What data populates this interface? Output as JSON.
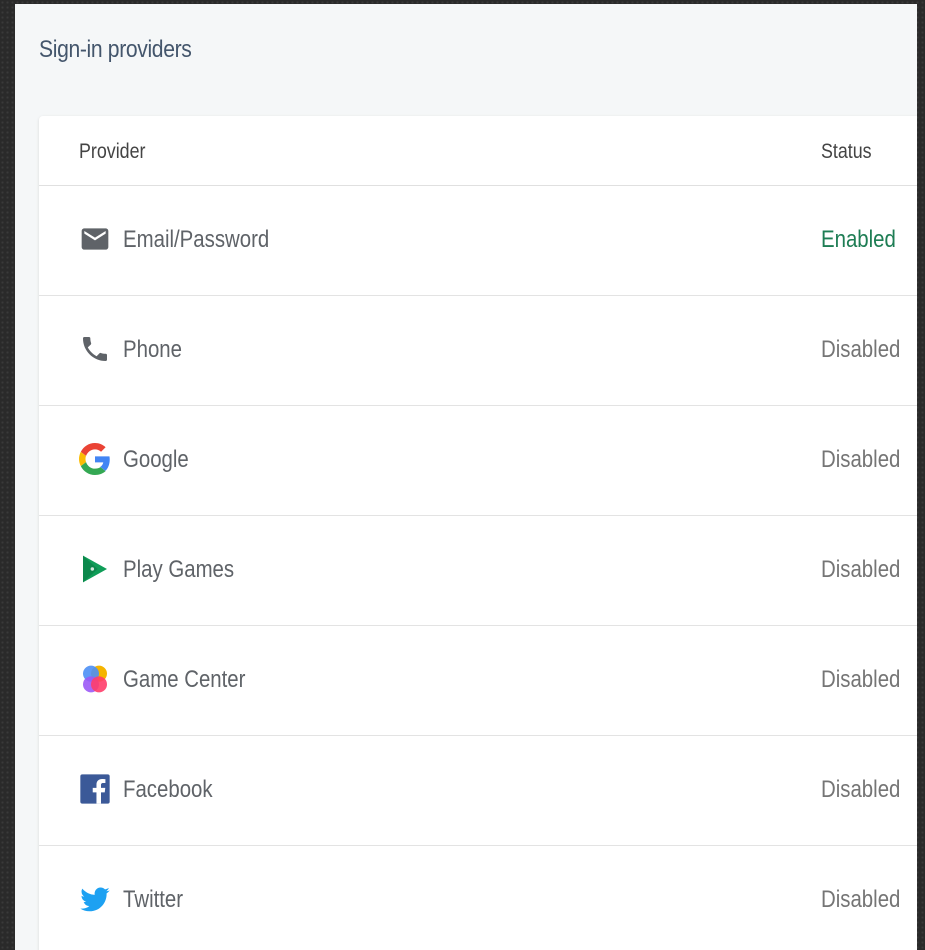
{
  "page": {
    "title": "Sign-in providers"
  },
  "table": {
    "headers": {
      "provider": "Provider",
      "status": "Status"
    },
    "rows": [
      {
        "name": "Email/Password",
        "status": "Enabled",
        "icon": "email-icon"
      },
      {
        "name": "Phone",
        "status": "Disabled",
        "icon": "phone-icon"
      },
      {
        "name": "Google",
        "status": "Disabled",
        "icon": "google-icon"
      },
      {
        "name": "Play Games",
        "status": "Disabled",
        "icon": "play-games-icon"
      },
      {
        "name": "Game Center",
        "status": "Disabled",
        "icon": "game-center-icon"
      },
      {
        "name": "Facebook",
        "status": "Disabled",
        "icon": "facebook-icon"
      },
      {
        "name": "Twitter",
        "status": "Disabled",
        "icon": "twitter-icon"
      }
    ]
  },
  "colors": {
    "enabled": "#1e7d54",
    "disabled": "#757575",
    "title": "#44566c"
  }
}
